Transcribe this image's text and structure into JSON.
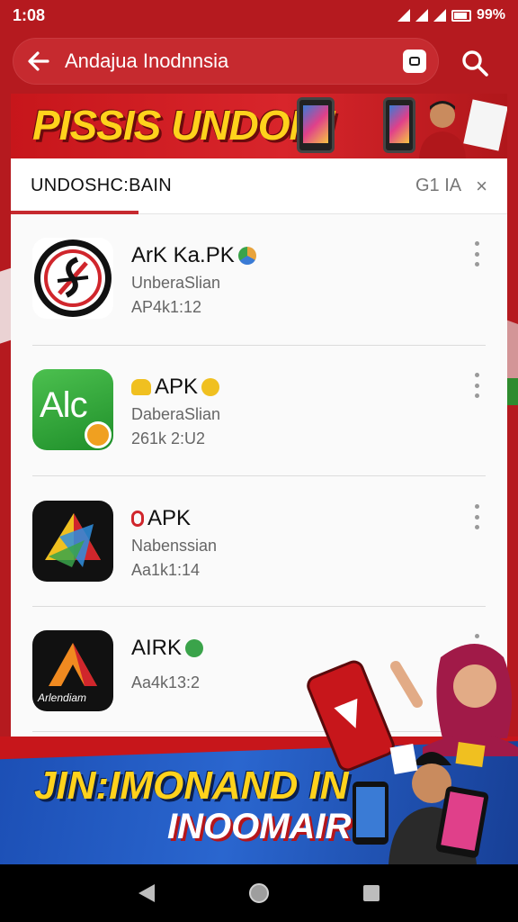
{
  "status_bar": {
    "time": "1:08",
    "battery": "99%"
  },
  "search": {
    "query": "Andajua Inodnnsia"
  },
  "top_banner": {
    "headline": "PISSIS UNDOM!"
  },
  "panel": {
    "tab_label": "UNDOSHC:BAIN",
    "filter_label": "G1 IA",
    "close_label": "×"
  },
  "apps": [
    {
      "name": "ArK Ka.PK",
      "subtitle": "UnberaSlian",
      "meta": "AP4k1:12",
      "badge_color": "#e8a33c"
    },
    {
      "name": "APK",
      "subtitle": "DaberaSlian",
      "meta": "261k 2:U2",
      "badge_color": "#f0c020",
      "icon_text": "Alc"
    },
    {
      "name": "APK",
      "subtitle": "Nabenssian",
      "meta": "Aa1k1:14",
      "badge_color": "#d0262c"
    },
    {
      "name": "AIRK",
      "subtitle": "",
      "meta": "Aa4k13:2",
      "badge_color": "#3aa34a",
      "icon_text": "Arlendiam"
    }
  ],
  "bottom_banner": {
    "line1": "JIN:IMONAND IN",
    "line2": "INOOMAIR!"
  },
  "colors": {
    "brand_red": "#c62a2f",
    "banner_yellow": "#ffd21c",
    "banner_blue": "#2a66cf"
  },
  "icons": {
    "back": "arrow-left-icon",
    "voice": "voice-search-icon",
    "search": "search-icon",
    "nav_back": "triangle-back-icon",
    "nav_home": "circle-home-icon",
    "nav_recent": "square-recent-icon"
  }
}
